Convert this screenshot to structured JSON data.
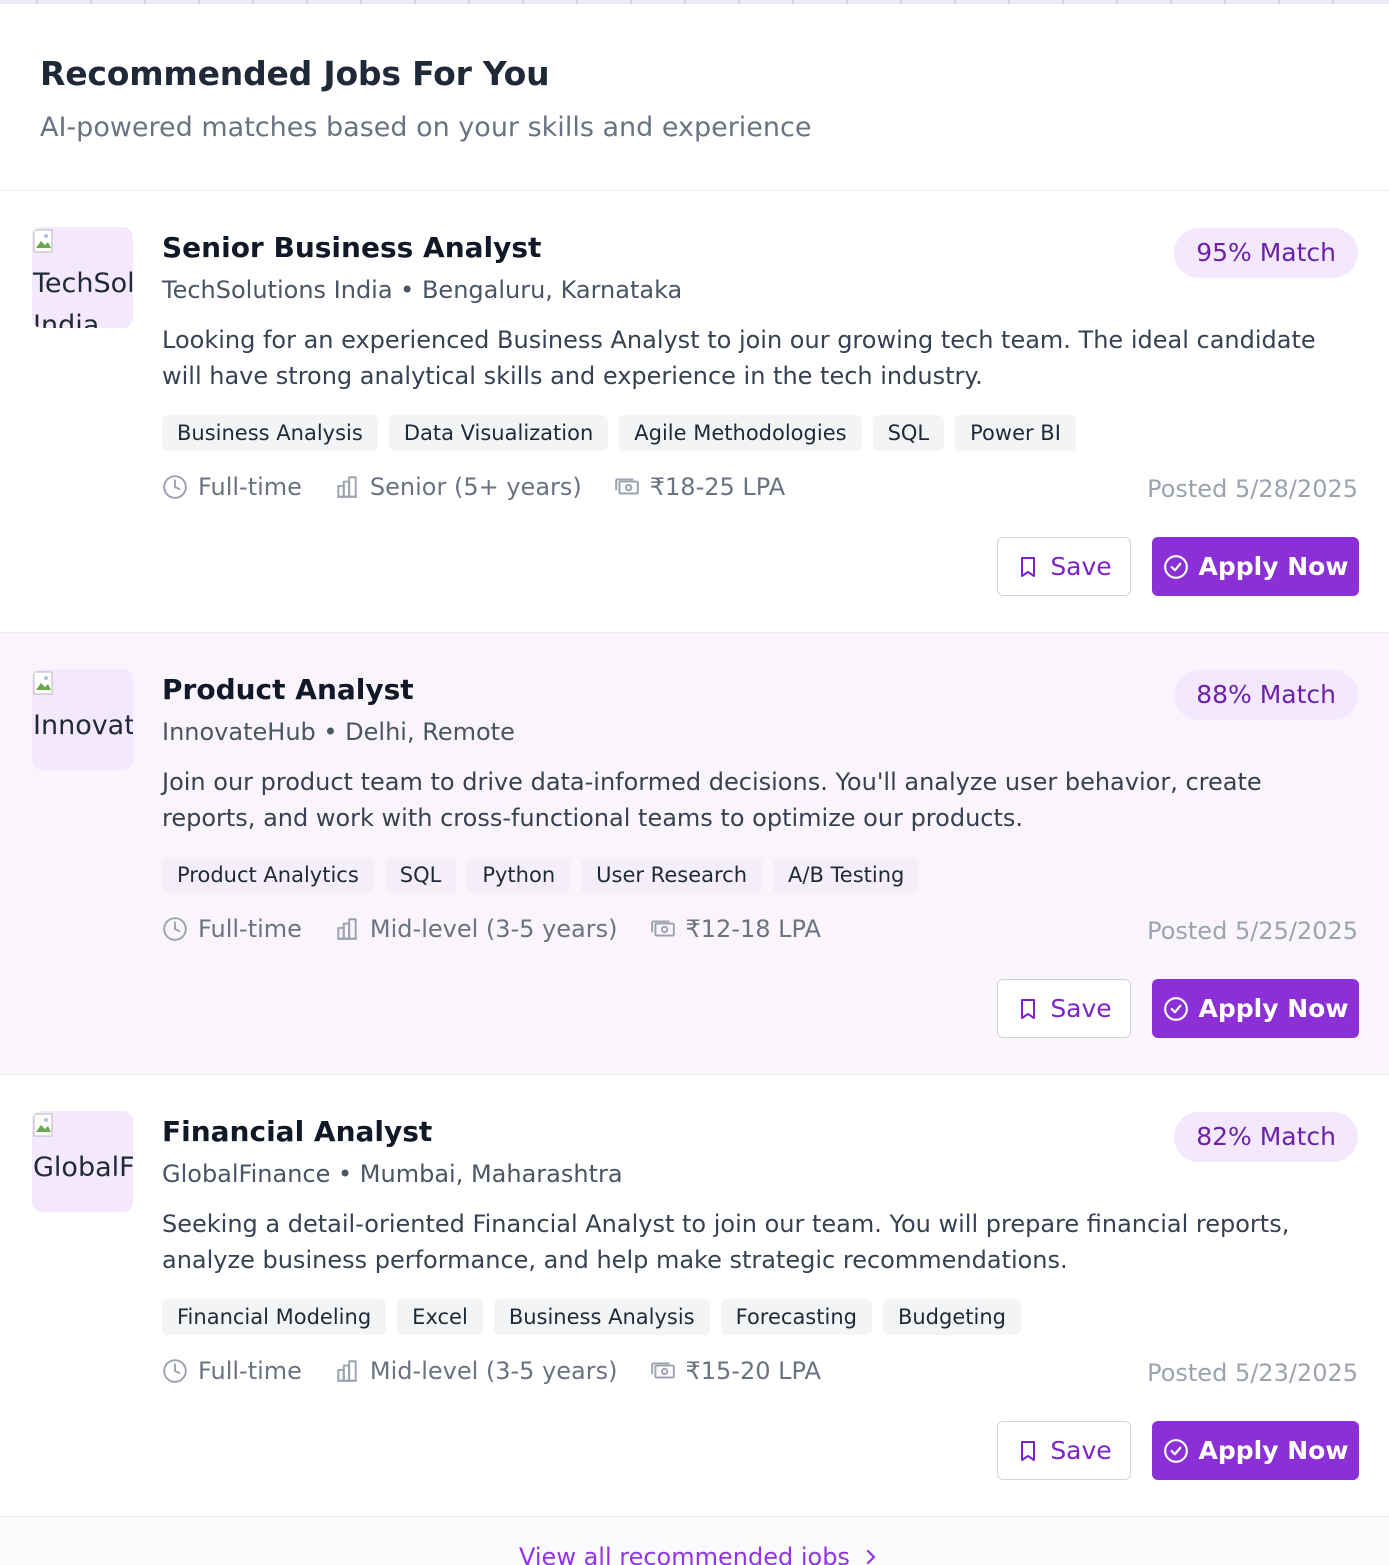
{
  "header": {
    "title": "Recommended Jobs For You",
    "subtitle": "AI-powered matches based on your skills and experience"
  },
  "jobs": [
    {
      "logo_alt": "TechSolutions India",
      "title": "Senior Business Analyst",
      "company_location": "TechSolutions India • Bengaluru, Karnataka",
      "description": "Looking for an experienced Business Analyst to join our growing tech team. The ideal candidate will have strong analytical skills and experience in the tech industry.",
      "match": "95% Match",
      "tags": [
        "Business Analysis",
        "Data Visualization",
        "Agile Methodologies",
        "SQL",
        "Power BI"
      ],
      "type": "Full-time",
      "level": "Senior (5+ years)",
      "salary": "₹18-25 LPA",
      "posted": "Posted 5/28/2025",
      "save_label": "Save",
      "apply_label": "Apply Now"
    },
    {
      "logo_alt": "InnovateHub",
      "title": "Product Analyst",
      "company_location": "InnovateHub • Delhi, Remote",
      "description": "Join our product team to drive data-informed decisions. You'll analyze user behavior, create reports, and work with cross-functional teams to optimize our products.",
      "match": "88% Match",
      "tags": [
        "Product Analytics",
        "SQL",
        "Python",
        "User Research",
        "A/B Testing"
      ],
      "type": "Full-time",
      "level": "Mid-level (3-5 years)",
      "salary": "₹12-18 LPA",
      "posted": "Posted 5/25/2025",
      "save_label": "Save",
      "apply_label": "Apply Now"
    },
    {
      "logo_alt": "GlobalFinance",
      "title": "Financial Analyst",
      "company_location": "GlobalFinance • Mumbai, Maharashtra",
      "description": "Seeking a detail-oriented Financial Analyst to join our team. You will prepare financial reports, analyze business performance, and help make strategic recommendations.",
      "match": "82% Match",
      "tags": [
        "Financial Modeling",
        "Excel",
        "Business Analysis",
        "Forecasting",
        "Budgeting"
      ],
      "type": "Full-time",
      "level": "Mid-level (3-5 years)",
      "salary": "₹15-20 LPA",
      "posted": "Posted 5/23/2025",
      "save_label": "Save",
      "apply_label": "Apply Now"
    }
  ],
  "footer": {
    "view_all_label": "View all recommended jobs"
  },
  "colors": {
    "accent": "#8b2fd6",
    "match_bg": "#f3e8fd",
    "highlight_row": "#faf5fd"
  },
  "icons": {
    "type": "clock-icon",
    "level": "building-icon",
    "salary": "banknote-icon",
    "save": "bookmark-icon",
    "apply": "check-circle-icon",
    "view_all": "chevron-right-icon"
  }
}
